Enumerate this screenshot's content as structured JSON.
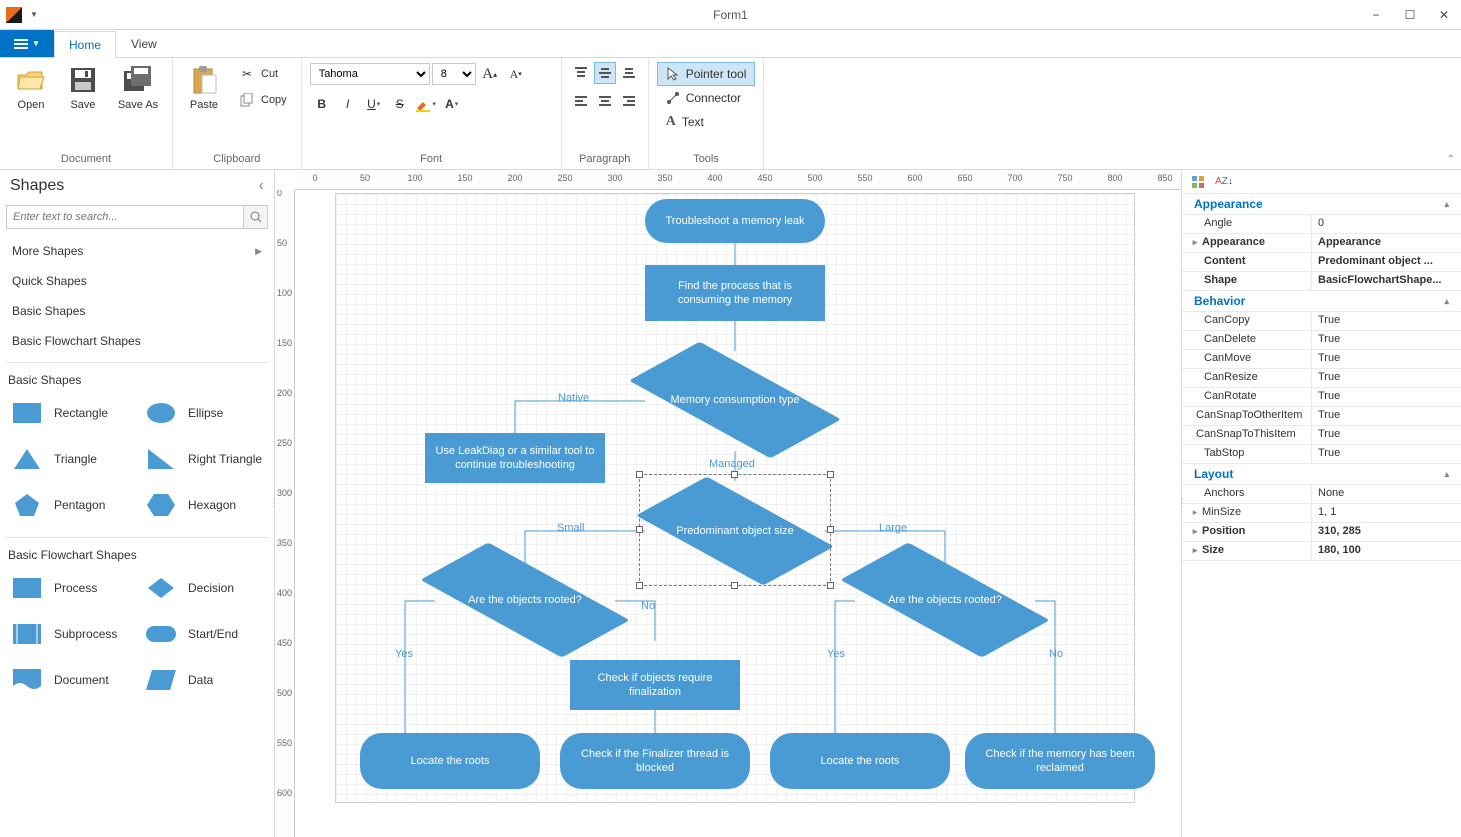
{
  "window": {
    "title": "Form1"
  },
  "ribbon": {
    "tabs": {
      "home": "Home",
      "view": "View"
    },
    "groups": {
      "document": {
        "label": "Document",
        "open": "Open",
        "save": "Save",
        "saveas": "Save As"
      },
      "clipboard": {
        "label": "Clipboard",
        "paste": "Paste",
        "cut": "Cut",
        "copy": "Copy"
      },
      "font": {
        "label": "Font",
        "family": "Tahoma",
        "size": "8"
      },
      "paragraph": {
        "label": "Paragraph"
      },
      "tools": {
        "label": "Tools",
        "pointer": "Pointer tool",
        "connector": "Connector",
        "text": "Text"
      }
    }
  },
  "shapes": {
    "title": "Shapes",
    "search_placeholder": "Enter text to search...",
    "nav": {
      "more": "More Shapes",
      "quick": "Quick Shapes",
      "basic": "Basic Shapes",
      "flow": "Basic Flowchart Shapes"
    },
    "basic": {
      "title": "Basic Shapes",
      "rectangle": "Rectangle",
      "ellipse": "Ellipse",
      "triangle": "Triangle",
      "right_triangle": "Right Triangle",
      "pentagon": "Pentagon",
      "hexagon": "Hexagon"
    },
    "flow": {
      "title": "Basic Flowchart Shapes",
      "process": "Process",
      "decision": "Decision",
      "subprocess": "Subprocess",
      "startend": "Start/End",
      "document": "Document",
      "data": "Data"
    }
  },
  "diagram": {
    "n1": "Troubleshoot a memory leak",
    "n2": "Find the process that is consuming the memory",
    "n3": "Memory consumption type",
    "n4": "Use LeakDiag or a similar tool to continue troubleshooting",
    "n5": "Predominant object size",
    "n6a": "Are the objects rooted?",
    "n6b": "Are the objects rooted?",
    "n7": "Check if objects require finalization",
    "t1": "Locate the roots",
    "t2": "Check if the Finalizer thread is blocked",
    "t3": "Locate the roots",
    "t4": "Check if the memory has been reclaimed",
    "labels": {
      "native": "Native",
      "managed": "Managed",
      "small": "Small",
      "large": "Large",
      "yes": "Yes",
      "no": "No"
    }
  },
  "props": {
    "cats": {
      "appearance": "Appearance",
      "behavior": "Behavior",
      "layout": "Layout"
    },
    "appearance": {
      "angle": {
        "k": "Angle",
        "v": "0"
      },
      "appearance": {
        "k": "Appearance",
        "v": "Appearance"
      },
      "content": {
        "k": "Content",
        "v": "Predominant object ..."
      },
      "shape": {
        "k": "Shape",
        "v": "BasicFlowchartShape..."
      }
    },
    "behavior": {
      "cancopy": {
        "k": "CanCopy",
        "v": "True"
      },
      "candelete": {
        "k": "CanDelete",
        "v": "True"
      },
      "canmove": {
        "k": "CanMove",
        "v": "True"
      },
      "canresize": {
        "k": "CanResize",
        "v": "True"
      },
      "canrotate": {
        "k": "CanRotate",
        "v": "True"
      },
      "cansnapother": {
        "k": "CanSnapToOtherItem",
        "v": "True"
      },
      "cansnapthis": {
        "k": "CanSnapToThisItem",
        "v": "True"
      },
      "tabstop": {
        "k": "TabStop",
        "v": "True"
      }
    },
    "layout": {
      "anchors": {
        "k": "Anchors",
        "v": "None"
      },
      "minsize": {
        "k": "MinSize",
        "v": "1, 1"
      },
      "position": {
        "k": "Position",
        "v": "310, 285"
      },
      "size": {
        "k": "Size",
        "v": "180, 100"
      }
    }
  },
  "ruler_h": [
    "0",
    "50",
    "100",
    "150",
    "200",
    "250",
    "300",
    "350",
    "400",
    "450",
    "500",
    "550",
    "600",
    "650",
    "700",
    "750",
    "800",
    "850"
  ],
  "ruler_v": [
    "0",
    "50",
    "100",
    "150",
    "200",
    "250",
    "300",
    "350",
    "400",
    "450",
    "500",
    "550",
    "600"
  ]
}
